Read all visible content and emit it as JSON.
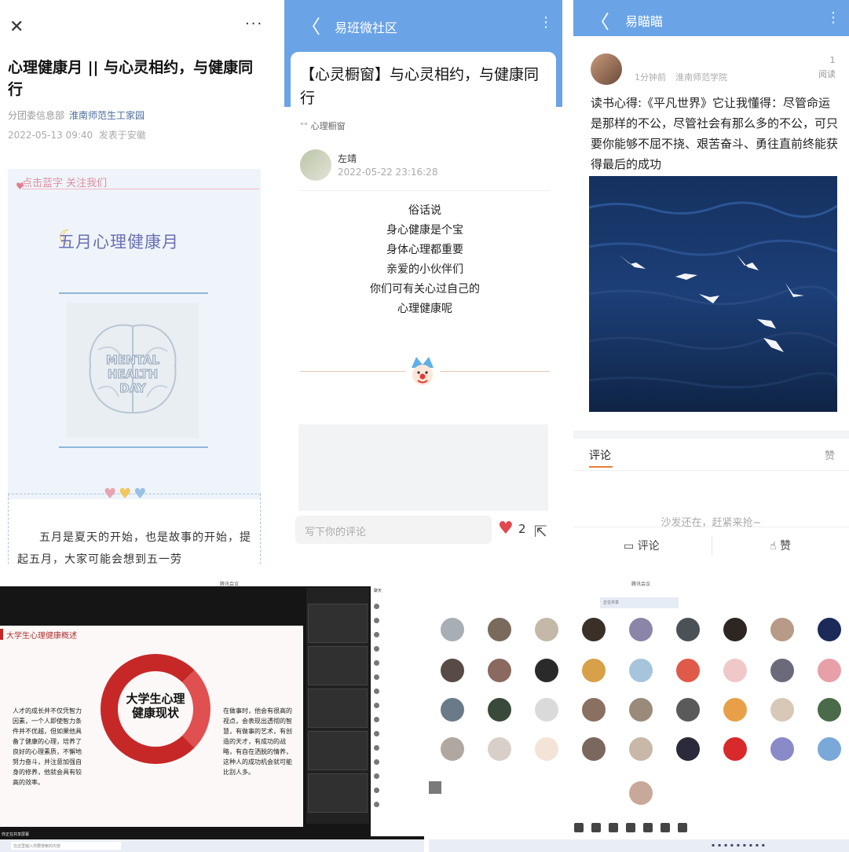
{
  "panel1": {
    "close_icon": "✕",
    "more_icon": "···",
    "title": "心理健康月 || 与心灵相约，与健康同行",
    "org": "分团委信息部",
    "source": "淮南师范生工家园",
    "datetime": "2022-05-13 09:40",
    "location": "发表于安徽",
    "follow_text": "点击蓝字 关注我们",
    "banner_title": "五月心理健康月",
    "image_text": "MENTAL HEALTH DAY",
    "paragraph": "五月是夏天的开始，也是故事的开始，提起五月，大家可能会想到五一劳"
  },
  "panel2": {
    "back_icon": "〈",
    "bar_title": "易班微社区",
    "more_icon": "⋮",
    "post_title": "【心灵橱窗】与心灵相约，与健康同行",
    "tag": "心理橱窗",
    "author": "左靖",
    "time": "2022-05-22 23:16:28",
    "poem": [
      "俗话说",
      "身心健康是个宝",
      "身体心理都重要",
      "亲爱的小伙伴们",
      "你们可有关心过自己的",
      "心理健康呢"
    ],
    "comment_placeholder": "写下你的评论",
    "like_count": "2"
  },
  "panel3": {
    "back_icon": "〈",
    "bar_title": "易瞄瞄",
    "more_icon": "⋮",
    "time": "1分钟前",
    "school": "淮南师范学院",
    "read_count": "1",
    "read_label": "阅读",
    "text": "读书心得:《平凡世界》它让我懂得：尽管命运是那样的不公，尽管社会有那么多的不公，可只要你能够不屈不挠、艰苦奋斗、勇往直前终能获得最后的成功",
    "tab_comment": "评论",
    "tab_like": "赞",
    "empty_text": "沙发还在，赶紧来抢~",
    "btn_comment": "评论",
    "btn_like": "赞"
  },
  "panel4": {
    "window_title": "腾讯会议",
    "slide_title": "大学生心理健康概述",
    "center_text": "大学生心理健康现状",
    "left_text": "人才的成长并不仅凭智力因素，一个人即使智力条件并不优越，但如果他具备了健康的心理，培养了良好的心理素质，不懈地努力奋斗，并注意加强自身的修养，他就会具有较高的效率。",
    "right_text": "在做事时，他会有很高的视点，会表现出透彻的智慧，有做事的艺术，有创造的天才，有成功的战略，有自在洒脱的情养，这种人的成功机会就可能比别人多。",
    "chat_title": "聊天",
    "search_hint": "在这里输入你要搜索的内容",
    "status": "你正在共享屏幕"
  },
  "panel5": {
    "window_title": "腾讯会议",
    "search_hint": "正在共享"
  }
}
